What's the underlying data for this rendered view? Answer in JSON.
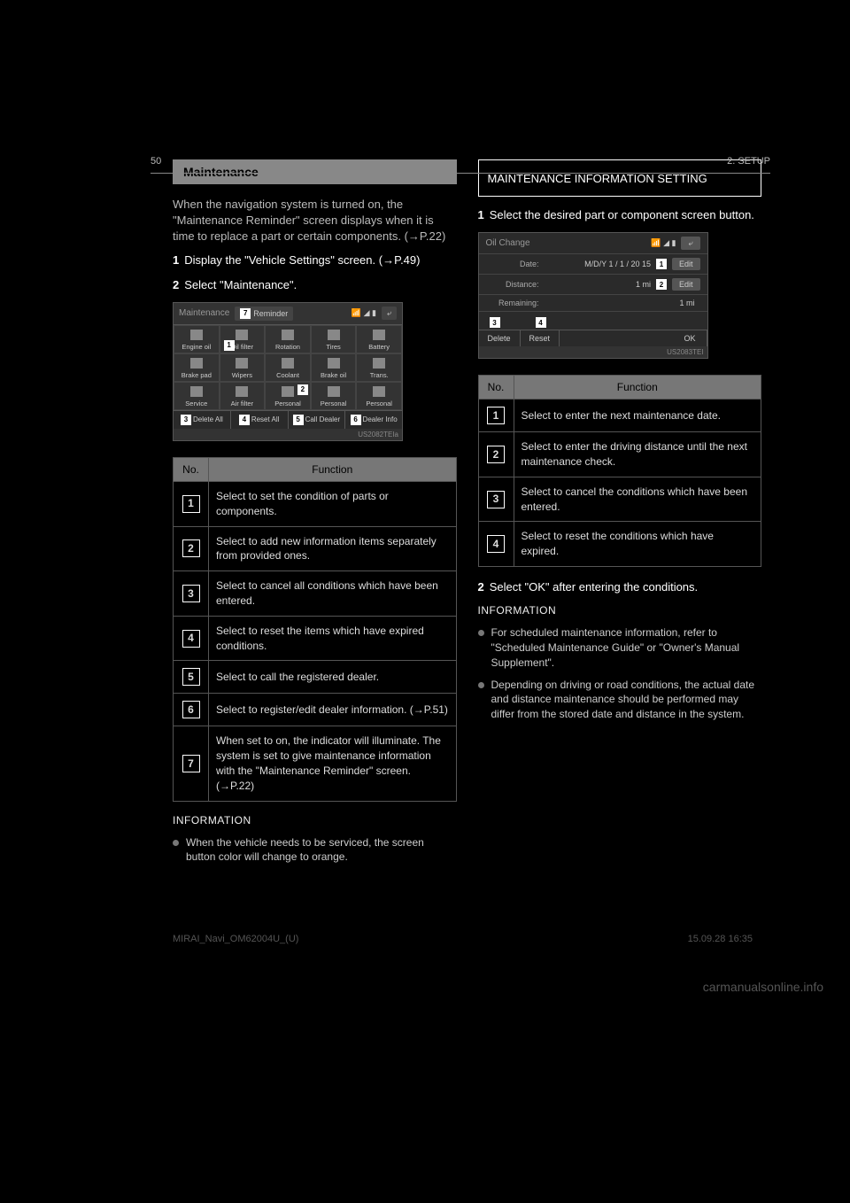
{
  "header": {
    "page_number": "50",
    "section": "2. SETUP"
  },
  "left": {
    "banner": "Maintenance",
    "intro_a": "When the navigation system is turned on, the \"Maintenance Reminder\" screen displays when it is time to replace a part or certain components. (→P.22)",
    "step1_num": "1",
    "step1": "Display the \"Vehicle Settings\" screen. (→P.49)",
    "step2_num": "2",
    "step2": "Select \"Maintenance\".",
    "table": {
      "header_no": "No.",
      "header_fn": "Function",
      "rows": [
        {
          "n": "1",
          "fn": "Select to set the condition of parts or components."
        },
        {
          "n": "2",
          "fn": "Select to add new information items separately from provided ones."
        },
        {
          "n": "3",
          "fn": "Select to cancel all conditions which have been entered."
        },
        {
          "n": "4",
          "fn": "Select to reset the items which have expired conditions."
        },
        {
          "n": "5",
          "fn": "Select to call the registered dealer."
        },
        {
          "n": "6",
          "fn": "Select to register/edit dealer information. (→P.51)"
        },
        {
          "n": "7",
          "fn": "When set to on, the indicator will illuminate. The system is set to give maintenance information with the \"Maintenance Reminder\" screen. (→P.22)"
        }
      ]
    },
    "info_head": "INFORMATION",
    "info_bullet": "When the vehicle needs to be serviced, the screen button color will change to orange."
  },
  "right": {
    "banner": "MAINTENANCE INFORMATION SETTING",
    "step1_num": "1",
    "step1": "Select the desired part or component screen button.",
    "table": {
      "header_no": "No.",
      "header_fn": "Function",
      "rows": [
        {
          "n": "1",
          "fn": "Select to enter the next maintenance date."
        },
        {
          "n": "2",
          "fn": "Select to enter the driving distance until the next maintenance check."
        },
        {
          "n": "3",
          "fn": "Select to cancel the conditions which have been entered."
        },
        {
          "n": "4",
          "fn": "Select to reset the conditions which have expired."
        }
      ]
    },
    "step2_num": "2",
    "step2": "Select \"OK\" after entering the conditions.",
    "info_head": "INFORMATION",
    "info_bullet_a": "For scheduled maintenance information, refer to \"Scheduled Maintenance Guide\" or \"Owner's Manual Supplement\".",
    "info_bullet_b": "Depending on driving or road conditions, the actual date and distance maintenance should be performed may differ from the stored date and distance in the system."
  },
  "screenshot1": {
    "title": "Maintenance",
    "tag": "7",
    "reminder": "Reminder",
    "back": "⤶",
    "grid_tag": "1",
    "grid": [
      "Engine oil",
      "Oil filter",
      "Rotation",
      "Tires",
      "Battery",
      "Brake pad",
      "Wipers",
      "Coolant",
      "Brake oil",
      "Trans.",
      "Service",
      "Air filter",
      "Personal",
      "Personal",
      "Personal"
    ],
    "grid_tag2a": "2",
    "grid_tag2b": "✓",
    "footer": [
      {
        "tag": "3",
        "label": "Delete All"
      },
      {
        "tag": "4",
        "label": "Reset All"
      },
      {
        "tag": "5",
        "label": "Call Dealer"
      },
      {
        "tag": "6",
        "label": "Dealer Info"
      }
    ],
    "id": "US2082TEIa"
  },
  "screenshot2": {
    "title": "Oil Change",
    "back": "⤶",
    "rows": [
      {
        "label": "Date:",
        "val": "M/D/Y   1 / 1 / 20 15",
        "tag": "1",
        "btn": "Edit"
      },
      {
        "label": "Distance:",
        "val": "1 mi",
        "tag": "2",
        "btn": "Edit"
      },
      {
        "label": "Remaining:",
        "val": "1 mi"
      }
    ],
    "footer": [
      {
        "tag": "3",
        "label": "Delete"
      },
      {
        "tag": "4",
        "label": "Reset"
      }
    ],
    "ok": "OK",
    "id": "US2083TEI"
  },
  "footer_notes": {
    "hybrid": "MIRAI_Navi_OM62004U_(U)",
    "date": "15.09.28     16:35"
  },
  "watermark": "carmanualsonline.info"
}
